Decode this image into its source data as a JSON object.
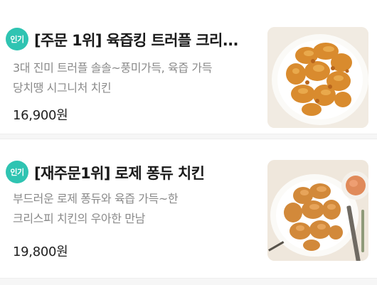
{
  "menu_items": [
    {
      "badge": "인기",
      "title": "[주문 1위] 육즙킹 트러플 크리...",
      "description_lines": [
        "3대 진미 트러플 솔솔~풍미가득, 육즙 가득",
        "당치땡 시그니처 치킨"
      ],
      "price": "16,900원",
      "image_icon": "fried-chicken-photo"
    },
    {
      "badge": "인기",
      "title": "[재주문1위] 로제 퐁듀 치킨",
      "description_lines": [
        "부드러운 로제 퐁듀와 육즙 가득~한",
        "크리스피 치킨의 우아한 만남"
      ],
      "price": "19,800원",
      "image_icon": "rose-fondue-chicken-photo"
    }
  ],
  "colors": {
    "badge_bg": "#2fc4b2",
    "title_text": "#1a1a1a",
    "description_text": "#8a8a8a",
    "price_text": "#1f1f1f"
  }
}
